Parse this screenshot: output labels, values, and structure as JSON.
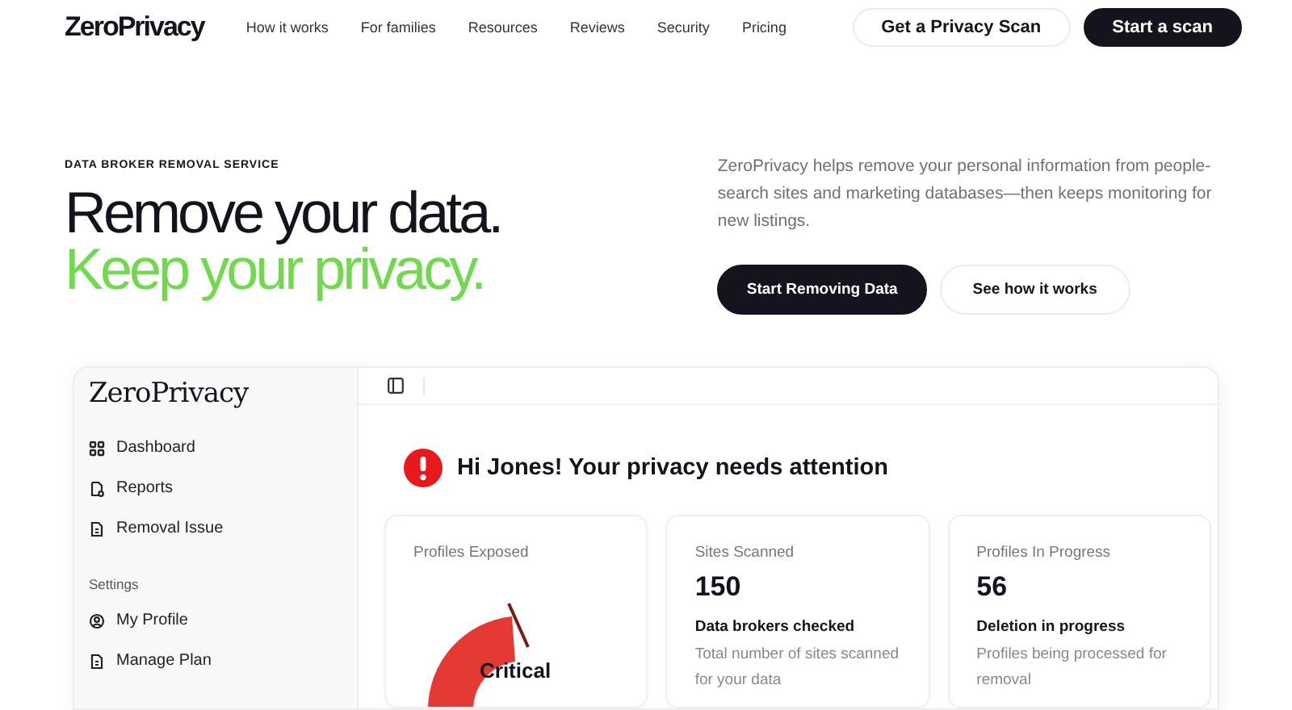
{
  "nav": {
    "logo": "ZeroPrivacy",
    "links": [
      "How it works",
      "For families",
      "Resources",
      "Reviews",
      "Security",
      "Pricing"
    ],
    "buttons": [
      {
        "label": "Get a Privacy Scan",
        "kind": "outline"
      },
      {
        "label": "Start a scan",
        "kind": "solid"
      }
    ]
  },
  "hero": {
    "eyebrow": "DATA BROKER REMOVAL SERVICE",
    "headline": "Remove your data.",
    "headline_accent": "Keep your privacy.",
    "description": "ZeroPrivacy helps remove your personal information from people-search sites and marketing databases—then keeps monitoring for new listings.",
    "buttons": [
      {
        "label": "Start Removing Data",
        "kind": "solid"
      },
      {
        "label": "See how it works",
        "kind": "outline"
      }
    ]
  },
  "dashboard": {
    "logo": "ZeroPrivacy",
    "menu": [
      {
        "label": "Dashboard",
        "kind": "grid"
      },
      {
        "label": "Reports",
        "kind": "report"
      },
      {
        "label": "Removal Issue",
        "kind": "doc"
      }
    ],
    "settings_heading": "Settings",
    "settings": [
      {
        "label": "My Profile",
        "kind": "profile"
      },
      {
        "label": "Manage Plan",
        "kind": "doc"
      }
    ],
    "greeting": "Hi Jones! Your privacy needs attention",
    "cards": [
      {
        "kind": "gauge",
        "title": "Profiles Exposed",
        "status": "Critical"
      },
      {
        "kind": "stat",
        "title": "Sites Scanned",
        "value": "150",
        "subtitle": "Data brokers checked",
        "description": "Total number of sites scanned for your data"
      },
      {
        "kind": "stat",
        "title": "Profiles In Progress",
        "value": "56",
        "subtitle": "Deletion in progress",
        "description": "Profiles being processed for removal"
      }
    ]
  }
}
